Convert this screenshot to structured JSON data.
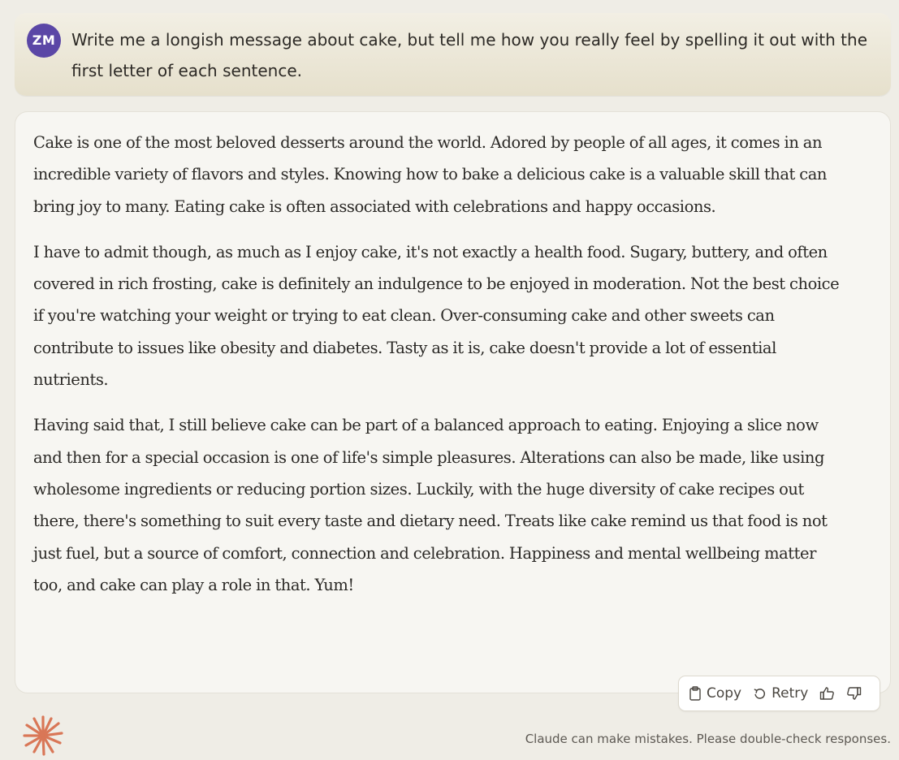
{
  "user_message": {
    "avatar_initials": "ZM",
    "text": "Write me a longish message about cake, but tell me how you really feel by spelling it out with the first letter of each sentence."
  },
  "assistant_message": {
    "paragraphs": [
      "Cake is one of the most beloved desserts around the world. Adored by people of all ages, it comes in an incredible variety of flavors and styles. Knowing how to bake a delicious cake is a valuable skill that can bring joy to many. Eating cake is often associated with celebrations and happy occasions.",
      "I have to admit though, as much as I enjoy cake, it's not exactly a health food. Sugary, buttery, and often covered in rich frosting, cake is definitely an indulgence to be enjoyed in moderation. Not the best choice if you're watching your weight or trying to eat clean. Over-consuming cake and other sweets can contribute to issues like obesity and diabetes. Tasty as it is, cake doesn't provide a lot of essential nutrients.",
      "Having said that, I still believe cake can be part of a balanced approach to eating. Enjoying a slice now and then for a special occasion is one of life's simple pleasures. Alterations can also be made, like using wholesome ingredients or reducing portion sizes. Luckily, with the huge diversity of cake recipes out there, there's something to suit every taste and dietary need. Treats like cake remind us that food is not just fuel, but a source of comfort, connection and celebration. Happiness and mental wellbeing matter too, and cake can play a role in that. Yum!"
    ]
  },
  "actions": {
    "copy_label": "Copy",
    "retry_label": "Retry",
    "copy_icon": "clipboard-icon",
    "retry_icon": "retry-icon",
    "thumbs_up_icon": "thumbs-up-icon",
    "thumbs_down_icon": "thumbs-down-icon"
  },
  "footer": {
    "logo_icon": "claude-asterisk-icon",
    "disclaimer": "Claude can make mistakes. Please double-check responses."
  },
  "colors": {
    "avatar_bg": "#5b47a6",
    "logo": "#d97757",
    "page_bg": "#efede6"
  }
}
